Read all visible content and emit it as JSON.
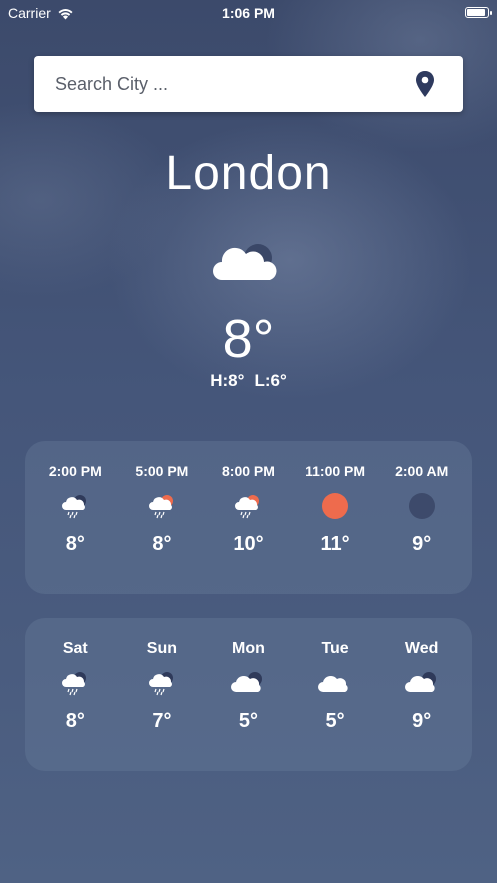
{
  "status": {
    "carrier": "Carrier",
    "time": "1:06 PM"
  },
  "search": {
    "placeholder": "Search City ..."
  },
  "city": "London",
  "current": {
    "icon": "cloudy-icon",
    "temp": "8°",
    "high": "H:8°",
    "low": "L:6°"
  },
  "hourly": [
    {
      "time": "2:00 PM",
      "icon": "night-rain-icon",
      "temp": "8°"
    },
    {
      "time": "5:00 PM",
      "icon": "sun-rain-icon",
      "temp": "8°"
    },
    {
      "time": "8:00 PM",
      "icon": "sun-rain-icon",
      "temp": "10°"
    },
    {
      "time": "11:00 PM",
      "icon": "sun-icon",
      "temp": "11°"
    },
    {
      "time": "2:00 AM",
      "icon": "moon-icon",
      "temp": "9°"
    }
  ],
  "daily": [
    {
      "day": "Sat",
      "icon": "night-rain-icon",
      "temp": "8°"
    },
    {
      "day": "Sun",
      "icon": "night-rain-icon",
      "temp": "7°"
    },
    {
      "day": "Mon",
      "icon": "night-cloudy-icon",
      "temp": "5°"
    },
    {
      "day": "Tue",
      "icon": "cloud-icon",
      "temp": "5°"
    },
    {
      "day": "Wed",
      "icon": "night-cloudy-icon",
      "temp": "9°"
    }
  ],
  "colors": {
    "sun": "#ee6b4d",
    "moon": "#3d4a6b",
    "card": "#5a6f90"
  }
}
